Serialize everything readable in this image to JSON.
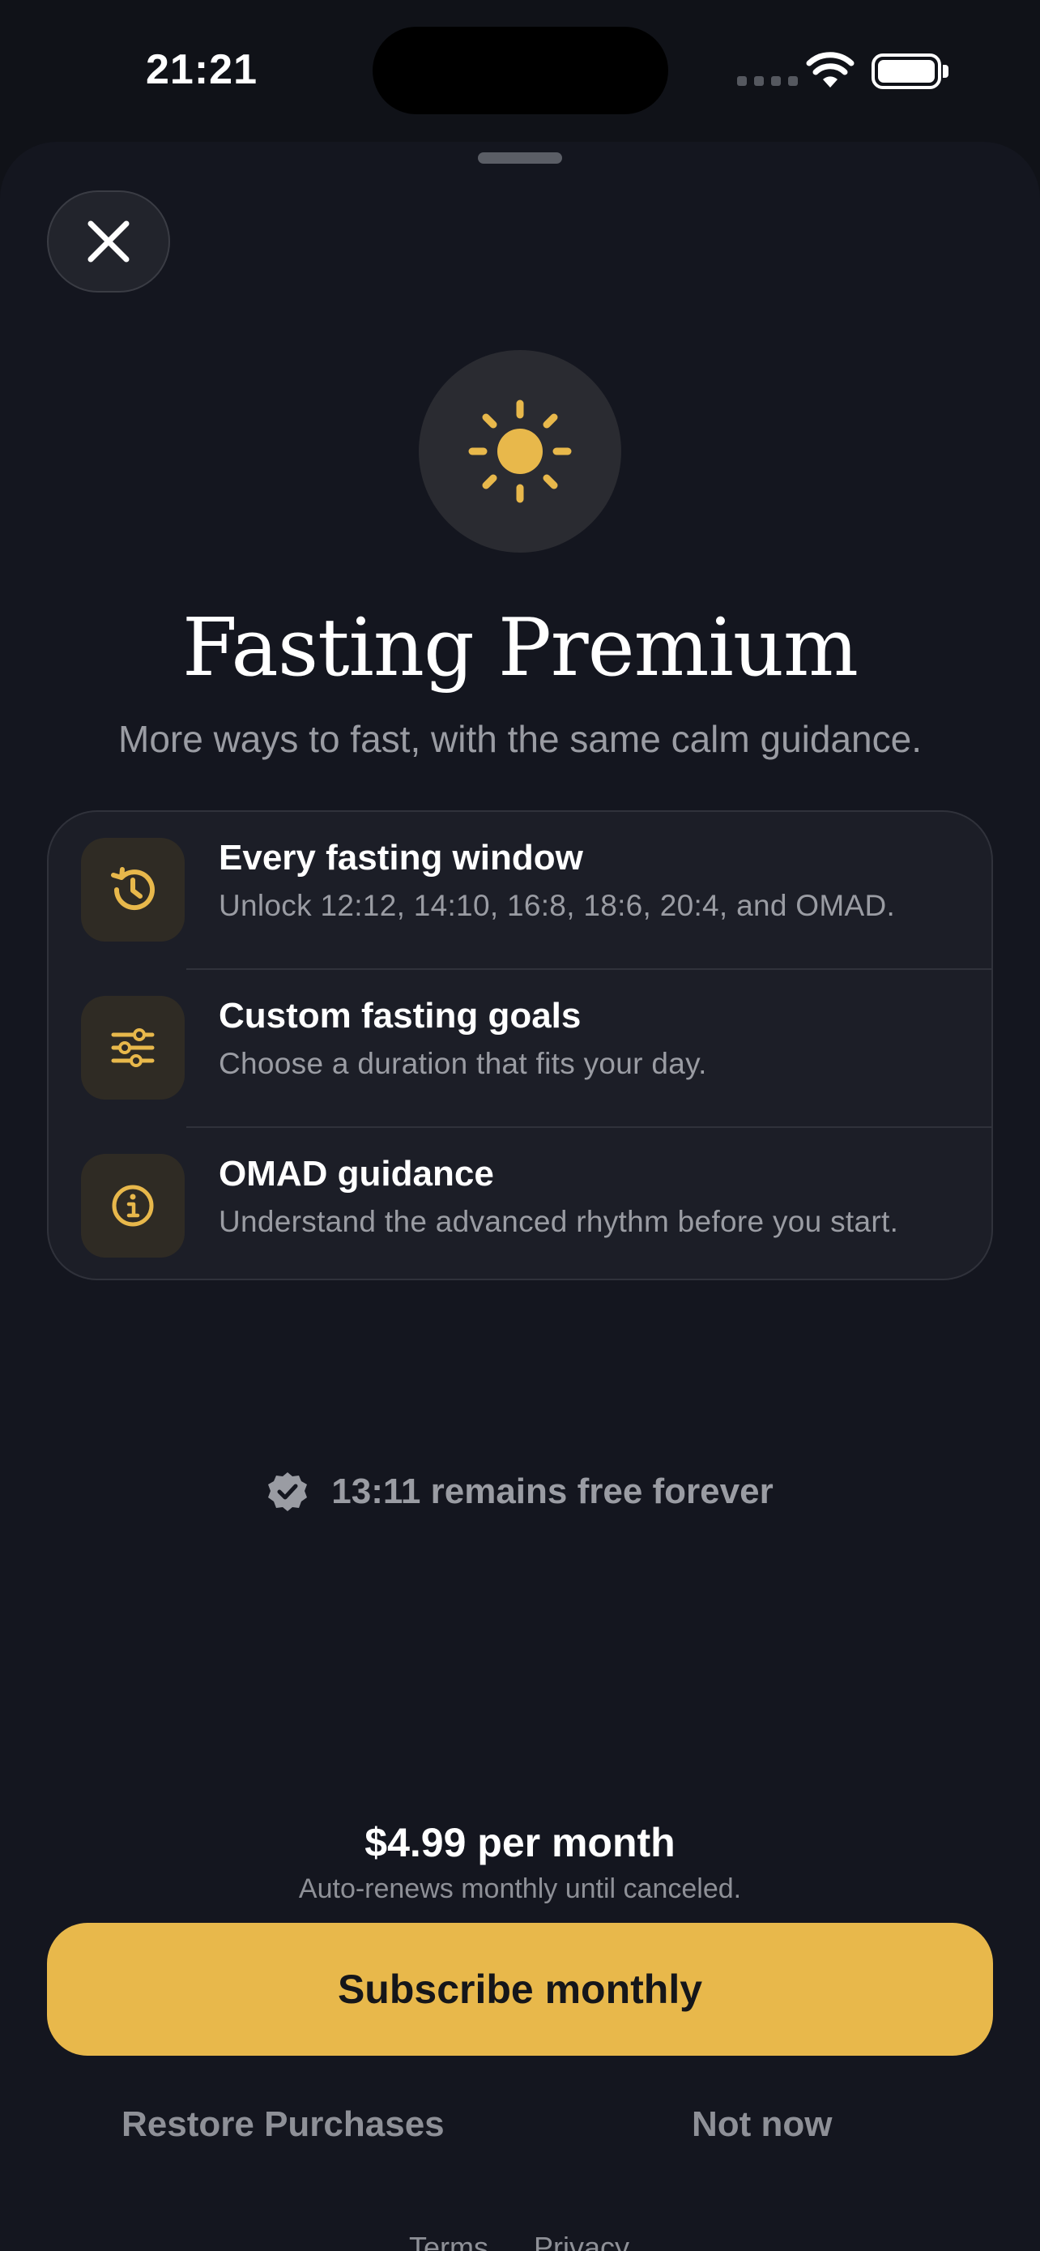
{
  "status_bar": {
    "time": "21:21",
    "icons": [
      "cellular-signal-icon",
      "wifi-icon",
      "battery-icon"
    ]
  },
  "sheet": {
    "close_icon": "close-icon",
    "hero_icon": "sun-icon",
    "title": "Fasting Premium",
    "subtitle": "More ways to fast, with the same calm guidance."
  },
  "features": [
    {
      "icon": "clock-history-icon",
      "title": "Every fasting window",
      "description": "Unlock 12:12, 14:10, 16:8, 18:6, 20:4, and OMAD."
    },
    {
      "icon": "sliders-icon",
      "title": "Custom fasting goals",
      "description": "Choose a duration that fits your day."
    },
    {
      "icon": "info-icon",
      "title": "OMAD guidance",
      "description": "Understand the advanced rhythm before you start."
    }
  ],
  "free_note": {
    "icon": "verified-badge-icon",
    "text": "13:11 remains free forever"
  },
  "pricing": {
    "price": "$4.99 per month",
    "renewal": "Auto-renews monthly until canceled."
  },
  "actions": {
    "subscribe": "Subscribe monthly",
    "restore": "Restore Purchases",
    "not_now": "Not now",
    "terms": "Terms",
    "privacy": "Privacy"
  },
  "colors": {
    "accent": "#e8b84b",
    "background": "#14161f",
    "card": "#1c1e27",
    "muted_text": "#9a9ca3"
  }
}
